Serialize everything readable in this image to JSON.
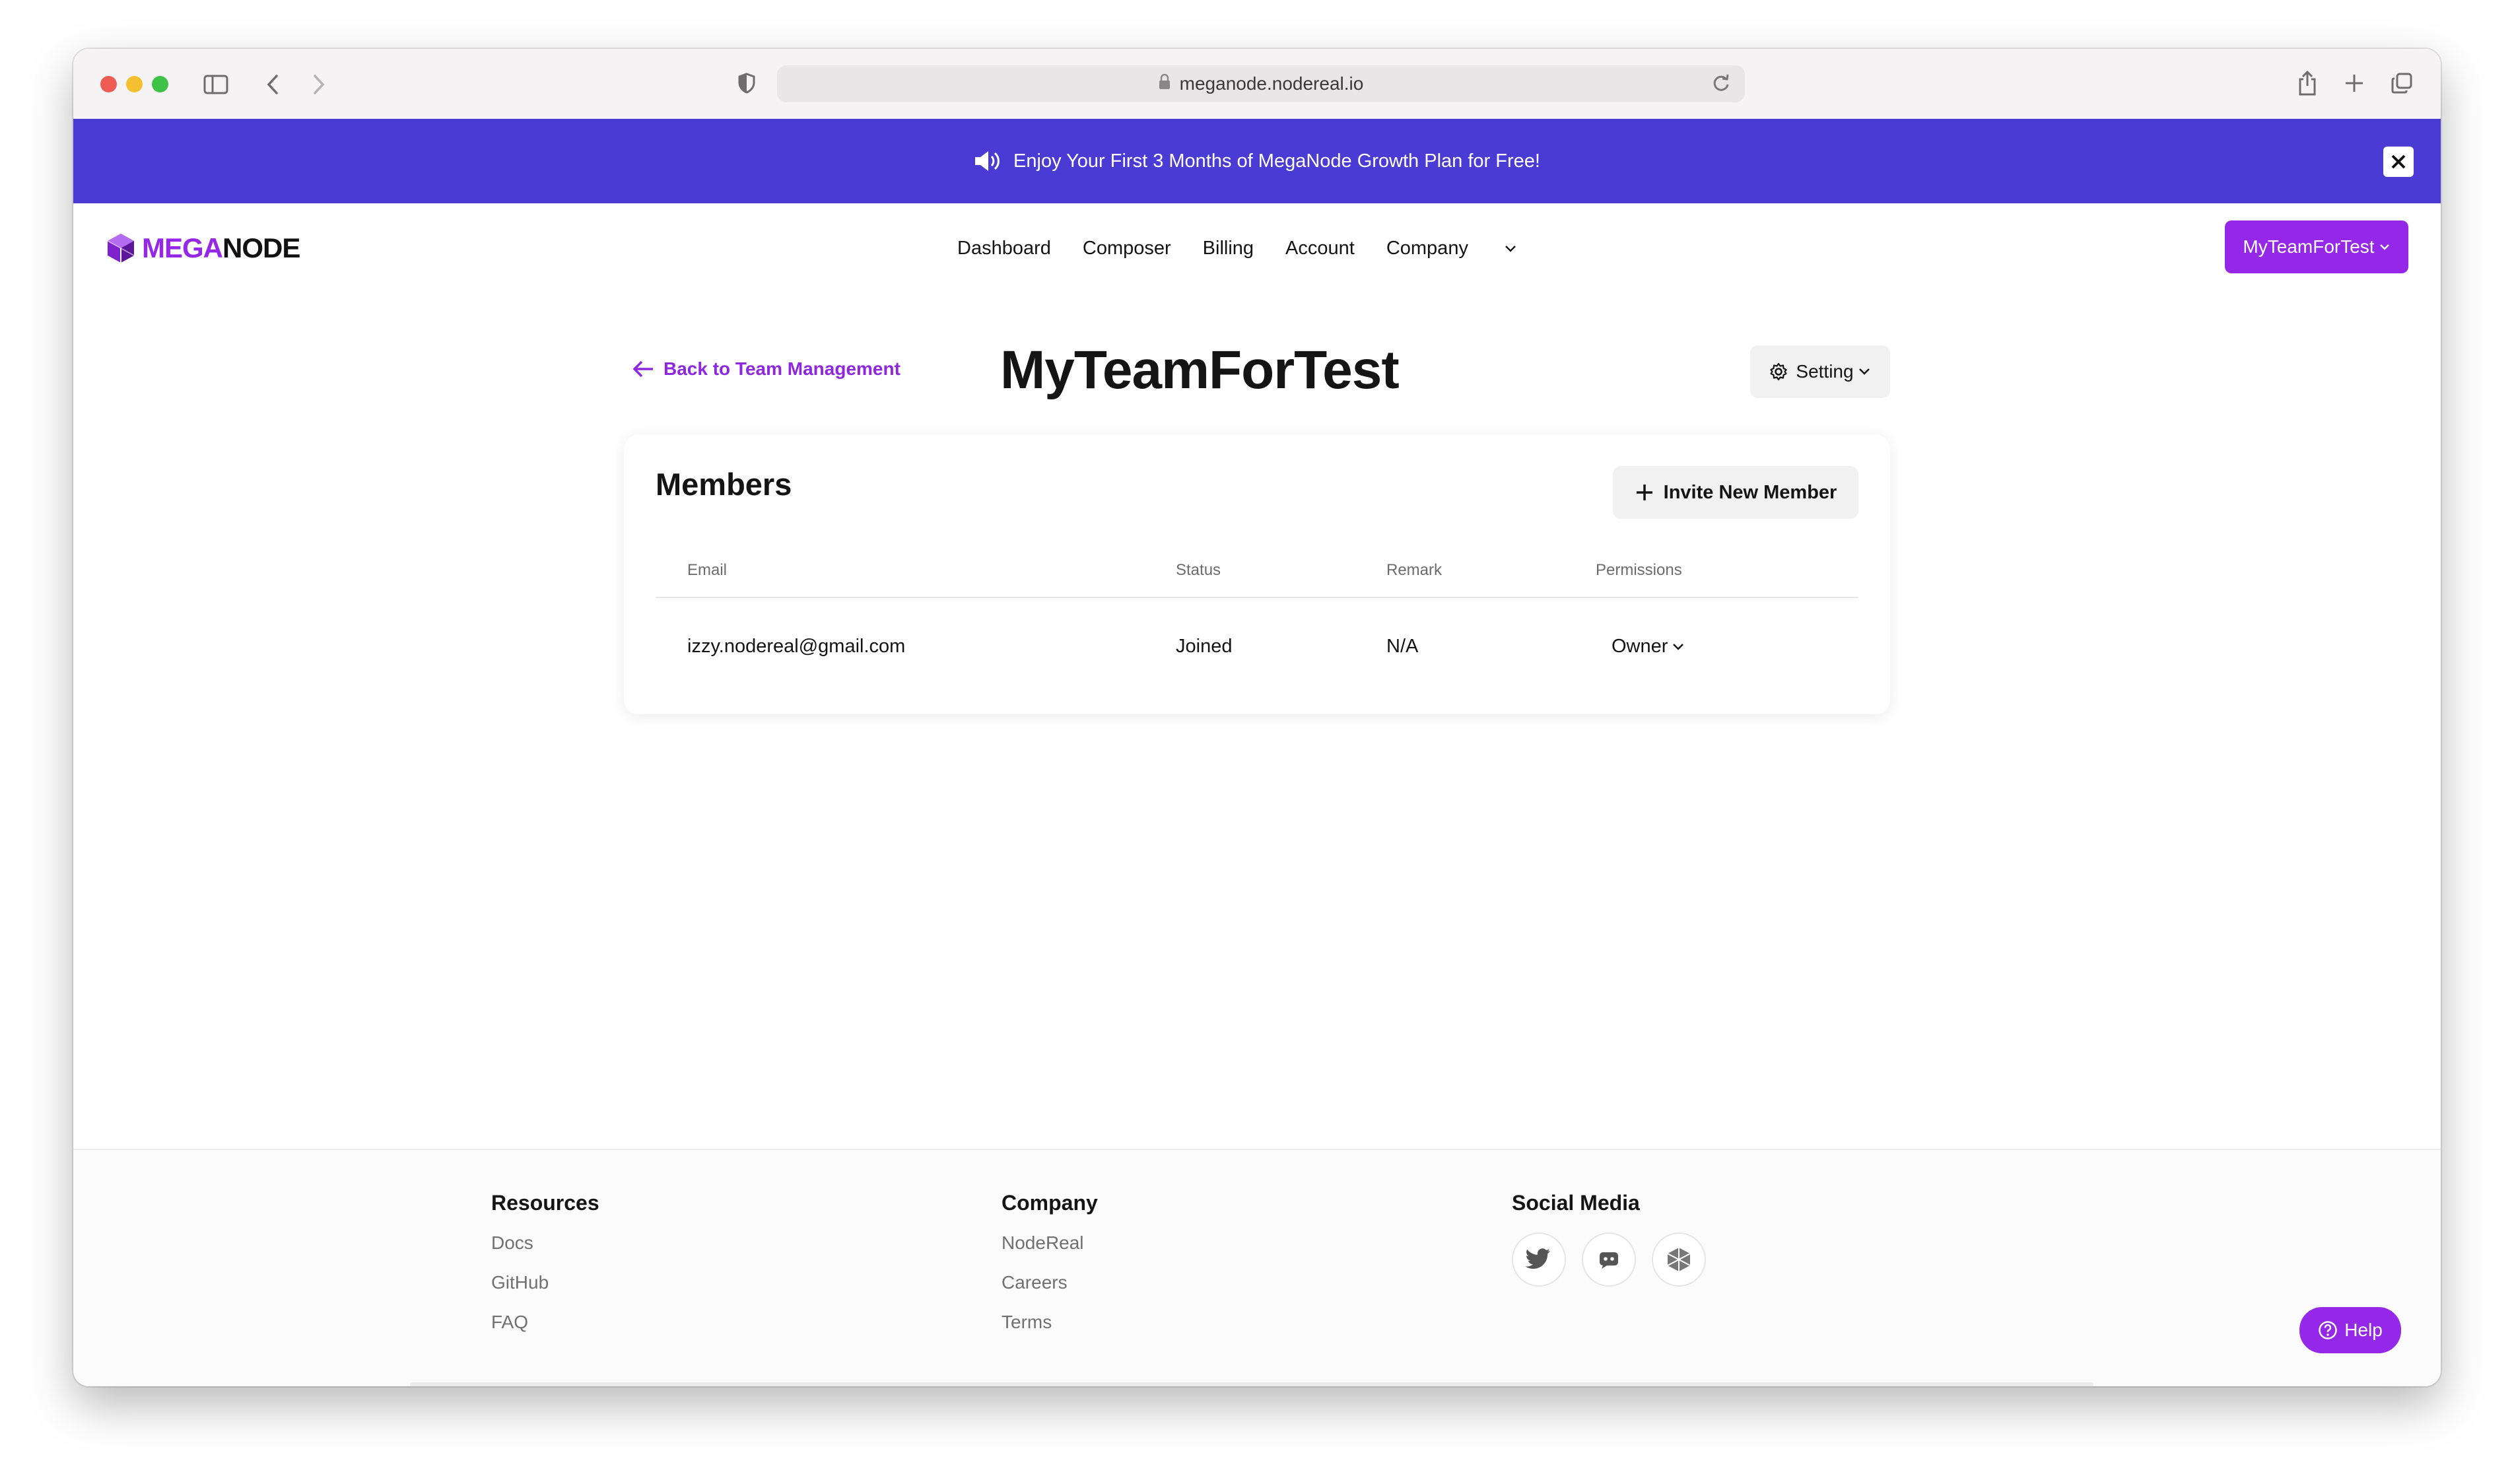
{
  "browser": {
    "url": "meganode.nodereal.io"
  },
  "banner": {
    "text": "Enjoy Your First 3 Months of MegaNode Growth Plan for Free!"
  },
  "logo": {
    "mega": "MEGA",
    "node": "NODE"
  },
  "nav": {
    "links": [
      "Dashboard",
      "Composer",
      "Billing",
      "Account",
      "Company"
    ],
    "team_button": "MyTeamForTest"
  },
  "header": {
    "back_label": "Back to Team Management",
    "title": "MyTeamForTest",
    "setting_label": "Setting"
  },
  "members": {
    "title": "Members",
    "invite_label": "Invite New Member",
    "columns": [
      "Email",
      "Status",
      "Remark",
      "Permissions"
    ],
    "rows": [
      {
        "email": "izzy.nodereal@gmail.com",
        "status": "Joined",
        "remark": "N/A",
        "permission": "Owner"
      }
    ]
  },
  "footer": {
    "resources": {
      "title": "Resources",
      "links": [
        "Docs",
        "GitHub",
        "FAQ"
      ]
    },
    "company": {
      "title": "Company",
      "links": [
        "NodeReal",
        "Careers",
        "Terms"
      ]
    },
    "social": {
      "title": "Social Media",
      "icons": [
        "twitter-icon",
        "discord-icon",
        "nodereal-icon"
      ]
    }
  },
  "help": {
    "label": "Help"
  },
  "colors": {
    "brand": "#9527e8",
    "banner": "#4a3bd4"
  }
}
